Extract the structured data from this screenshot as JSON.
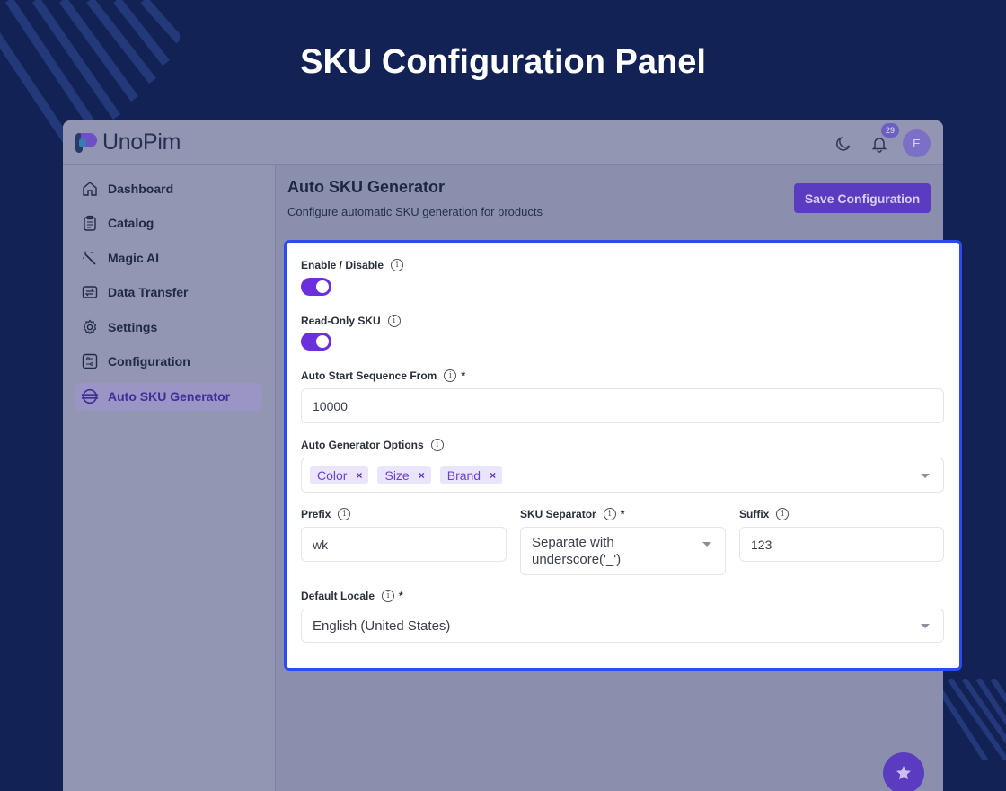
{
  "hero": {
    "title": "SKU Configuration Panel"
  },
  "app": {
    "logo_text": "UnoPim",
    "notifications_count": "29",
    "avatar_initial": "E"
  },
  "sidebar": {
    "items": [
      {
        "label": "Dashboard",
        "icon": "home-icon"
      },
      {
        "label": "Catalog",
        "icon": "clipboard-icon"
      },
      {
        "label": "Magic AI",
        "icon": "magic-wand-icon"
      },
      {
        "label": "Data Transfer",
        "icon": "data-transfer-icon"
      },
      {
        "label": "Settings",
        "icon": "gear-icon"
      },
      {
        "label": "Configuration",
        "icon": "sliders-icon"
      },
      {
        "label": "Auto SKU Generator",
        "icon": "sku-generator-icon",
        "active": true
      }
    ]
  },
  "page": {
    "title": "Auto SKU Generator",
    "subtitle": "Configure automatic SKU generation for products",
    "save_label": "Save Configuration"
  },
  "form": {
    "enable_label": "Enable / Disable",
    "enable_on": true,
    "readonly_label": "Read-Only SKU",
    "readonly_on": true,
    "start_seq_label": "Auto Start Sequence From",
    "start_seq_value": "10000",
    "options_label": "Auto Generator Options",
    "options_chips": [
      "Color",
      "Size",
      "Brand"
    ],
    "chip_remove": "×",
    "prefix_label": "Prefix",
    "prefix_value": "wk",
    "separator_label": "SKU Separator",
    "separator_value": "Separate with underscore('_')",
    "suffix_label": "Suffix",
    "suffix_value": "123",
    "locale_label": "Default Locale",
    "locale_value": "English (United States)",
    "required_mark": "*",
    "info_glyph": "i"
  },
  "colors": {
    "accent": "#6b2fdc",
    "panel_border": "#2c4cf0",
    "background": "#122254"
  }
}
